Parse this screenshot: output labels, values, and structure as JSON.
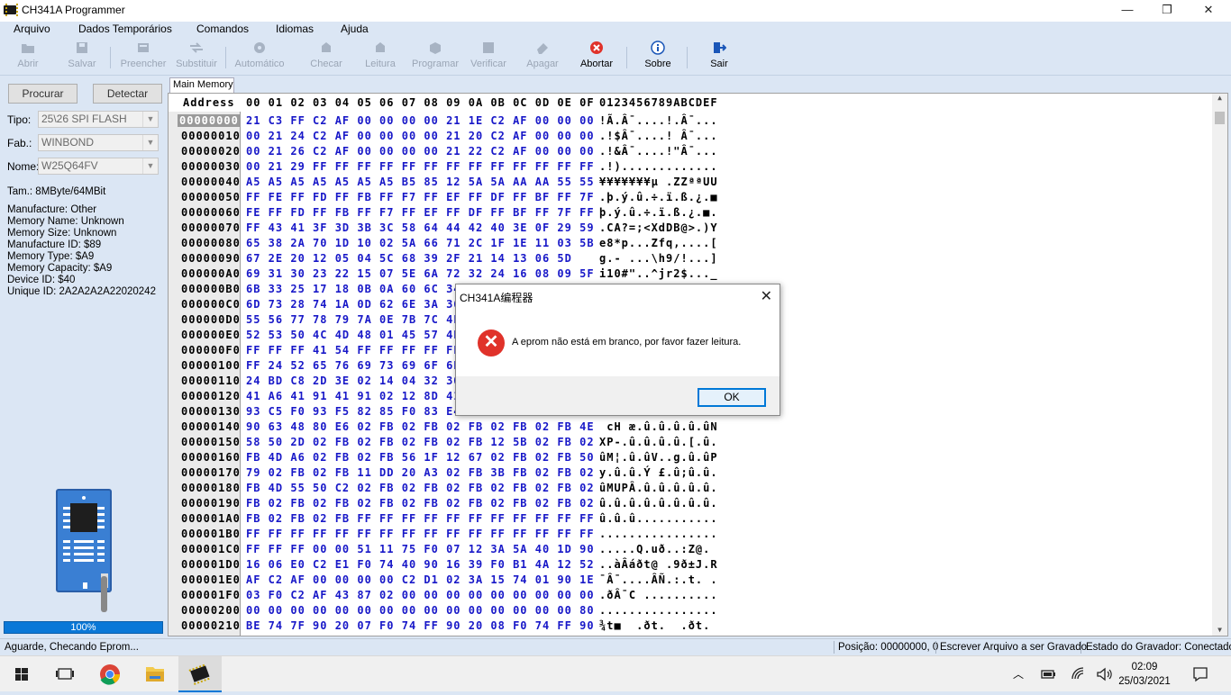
{
  "window": {
    "title": "CH341A Programmer",
    "minimize": "—",
    "restore": "❐",
    "close": "✕"
  },
  "menu": [
    "Arquivo",
    "Dados Temporários",
    "Comandos",
    "Idiomas",
    "Ajuda"
  ],
  "toolbar": [
    {
      "label": "Abrir",
      "icon": "open-folder-icon",
      "enabled": false
    },
    {
      "label": "Salvar",
      "icon": "save-icon",
      "enabled": false
    },
    {
      "label": "Preencher",
      "icon": "fill-icon",
      "enabled": false
    },
    {
      "label": "Substituir",
      "icon": "replace-icon",
      "enabled": false
    },
    {
      "label": "Automático",
      "icon": "auto-icon",
      "enabled": false
    },
    {
      "label": "Checar",
      "icon": "check-icon",
      "enabled": false
    },
    {
      "label": "Leitura",
      "icon": "read-icon",
      "enabled": false
    },
    {
      "label": "Programar",
      "icon": "program-icon",
      "enabled": false
    },
    {
      "label": "Verificar",
      "icon": "verify-icon",
      "enabled": false
    },
    {
      "label": "Apagar",
      "icon": "erase-icon",
      "enabled": false
    },
    {
      "label": "Abortar",
      "icon": "abort-icon",
      "enabled": true
    },
    {
      "label": "Sobre",
      "icon": "about-icon",
      "enabled": true
    },
    {
      "label": "Sair",
      "icon": "exit-icon",
      "enabled": true
    }
  ],
  "left_panel": {
    "search_button": "Procurar",
    "detect_button": "Detectar",
    "type_label": "Tipo:",
    "type_value": "25\\26 SPI FLASH",
    "manufacturer_label": "Fab.:",
    "manufacturer_value": "WINBOND",
    "name_label": "Nome:",
    "name_value": "W25Q64FV",
    "size_line": "Tam.:  8MByte/64MBit",
    "info": [
      "Manufacture: Other",
      "Memory Name: Unknown",
      "Memory Size: Unknown",
      "Manufacture ID: $89",
      "Memory Type: $A9",
      "Memory Capacity: $A9",
      "Device ID: $40",
      "Unique ID: 2A2A2A2A22020242"
    ],
    "progress_text": "100%",
    "progress_value": 1.0
  },
  "editor": {
    "tab": "Main Memory",
    "header_address": "Address",
    "header_hex": "00 01 02 03 04 05 06 07 08 09 0A 0B 0C 0D 0E 0F",
    "header_ascii": "0123456789ABCDEF",
    "rows": [
      {
        "addr": "00000000",
        "hex": "21 C3 FF C2 AF 00 00 00 00 21 1E C2 AF 00 00 00",
        "ascii": "!Ã.Â¯....!.Â¯..."
      },
      {
        "addr": "00000010",
        "hex": "00 21 24 C2 AF 00 00 00 00 21 20 C2 AF 00 00 00",
        "ascii": ".!$Â¯....! Â¯..."
      },
      {
        "addr": "00000020",
        "hex": "00 21 26 C2 AF 00 00 00 00 21 22 C2 AF 00 00 00",
        "ascii": ".!&Â¯....!\"Â¯..."
      },
      {
        "addr": "00000030",
        "hex": "00 21 29 FF FF FF FF FF FF FF FF FF FF FF FF FF",
        "ascii": ".!)............."
      },
      {
        "addr": "00000040",
        "hex": "A5 A5 A5 A5 A5 A5 A5 B5 85 12 5A 5A AA AA 55 55",
        "ascii": "¥¥¥¥¥¥¥µ .ZZªªUU"
      },
      {
        "addr": "00000050",
        "hex": "FF FE FF FD FF FB FF F7 FF EF FF DF FF BF FF 7F",
        "ascii": ".þ.ý.û.÷.ï.ß.¿.■"
      },
      {
        "addr": "00000060",
        "hex": "FE FF FD FF FB FF F7 FF EF FF DF FF BF FF 7F FF",
        "ascii": "þ.ý.û.÷.ï.ß.¿.■."
      },
      {
        "addr": "00000070",
        "hex": "FF 43 41 3F 3D 3B 3C 58 64 44 42 40 3E 0F 29 59",
        "ascii": ".CA?=;<XdDB@>.)Y"
      },
      {
        "addr": "00000080",
        "hex": "65 38 2A 70 1D 10 02 5A 66 71 2C 1F 1E 11 03 5B",
        "ascii": "e8*p...Zfq,....["
      },
      {
        "addr": "00000090",
        "hex": "67 2E 20 12 05 04 5C 68 39 2F 21 14 13 06 5D",
        "ascii": "g.- ...\\h9/!...]"
      },
      {
        "addr": "000000A0",
        "hex": "69 31 30 23 22 15 07 5E 6A 72 32 24 16 08 09 5F",
        "ascii": "i10#\"..^jr2$..._"
      },
      {
        "addr": "000000B0",
        "hex": "6B 33 25 17 18 0B 0A 60 6C 34",
        "ascii": ""
      },
      {
        "addr": "000000C0",
        "hex": "6D 73 28 74 1A 0D 62 6E 3A 36",
        "ascii": ""
      },
      {
        "addr": "000000D0",
        "hex": "55 56 77 78 79 7A 0E 7B 7C 4F",
        "ascii": ""
      },
      {
        "addr": "000000E0",
        "hex": "52 53 50 4C 4D 48 01 45 57 4E",
        "ascii": ""
      },
      {
        "addr": "000000F0",
        "hex": "FF FF FF 41 54 FF FF FF FF FF",
        "ascii": ""
      },
      {
        "addr": "00000100",
        "hex": "FF 24 52 65 76 69 73 69 6F 6E",
        "ascii": ""
      },
      {
        "addr": "00000110",
        "hex": "24 BD C8 2D 3E 02 14 04 32 30",
        "ascii": ""
      },
      {
        "addr": "00000120",
        "hex": "41 A6 41 91 41 91 02 12 8D 41",
        "ascii": ""
      },
      {
        "addr": "00000130",
        "hex": "93 C5 F0 93 F5 82 85 F0 83 E4",
        "ascii": ""
      },
      {
        "addr": "00000140",
        "hex": "90 63 48 80 E6 02 FB 02 FB 02 FB 02 FB 02 FB 4E",
        "ascii": " cH æ.û.û.û.û.ûN"
      },
      {
        "addr": "00000150",
        "hex": "58 50 2D 02 FB 02 FB 02 FB 02 FB 12 5B 02 FB 02",
        "ascii": "XP-.û.û.û.û.[.û."
      },
      {
        "addr": "00000160",
        "hex": "FB 4D A6 02 FB 02 FB 56 1F 12 67 02 FB 02 FB 50",
        "ascii": "ûM¦.û.ûV..g.û.ûP"
      },
      {
        "addr": "00000170",
        "hex": "79 02 FB 02 FB 11 DD 20 A3 02 FB 3B FB 02 FB 02",
        "ascii": "y.û.û.Ý £.û;û.û."
      },
      {
        "addr": "00000180",
        "hex": "FB 4D 55 50 C2 02 FB 02 FB 02 FB 02 FB 02 FB 02",
        "ascii": "ûMUPÂ.û.û.û.û.û."
      },
      {
        "addr": "00000190",
        "hex": "FB 02 FB 02 FB 02 FB 02 FB 02 FB 02 FB 02 FB 02",
        "ascii": "û.û.û.û.û.û.û.û."
      },
      {
        "addr": "000001A0",
        "hex": "FB 02 FB 02 FB FF FF FF FF FF FF FF FF FF FF FF",
        "ascii": "û.û.û..........."
      },
      {
        "addr": "000001B0",
        "hex": "FF FF FF FF FF FF FF FF FF FF FF FF FF FF FF FF",
        "ascii": "................"
      },
      {
        "addr": "000001C0",
        "hex": "FF FF FF 00 00 51 11 75 F0 07 12 3A 5A 40 1D 90",
        "ascii": ".....Q.uð..:Z@."
      },
      {
        "addr": "000001D0",
        "hex": "16 06 E0 C2 E1 F0 74 40 90 16 39 F0 B1 4A 12 52",
        "ascii": "..àÂáðt@ .9ð±J.R"
      },
      {
        "addr": "000001E0",
        "hex": "AF C2 AF 00 00 00 00 C2 D1 02 3A 15 74 01 90 1E",
        "ascii": "¯Â¯....ÂÑ.:.t. ."
      },
      {
        "addr": "000001F0",
        "hex": "03 F0 C2 AF 43 87 02 00 00 00 00 00 00 00 00 00",
        "ascii": ".ðÂ¯C .........."
      },
      {
        "addr": "00000200",
        "hex": "00 00 00 00 00 00 00 00 00 00 00 00 00 00 00 80",
        "ascii": "................"
      },
      {
        "addr": "00000210",
        "hex": "BE 74 7F 90 20 07 F0 74 FF 90 20 08 F0 74 FF 90",
        "ascii": "¾t■  .ðt.  .ðt. "
      }
    ]
  },
  "dialog": {
    "title": "CH341A编程器",
    "message": "A eprom não está em branco, por favor fazer leitura.",
    "ok": "OK"
  },
  "statusbar": {
    "left": "Aguarde, Checando Eprom...",
    "position": "Posição: 00000000, 0",
    "write_file": "Escrever Arquivo a ser Gravado",
    "state": "Estado do Gravador: Conectado."
  },
  "taskbar": {
    "time": "02:09",
    "date": "25/03/2021"
  },
  "colors": {
    "hex_text": "#1818c8",
    "window_bg": "#dbe6f4",
    "progress": "#0a78d7",
    "error_icon": "#e0322a"
  }
}
